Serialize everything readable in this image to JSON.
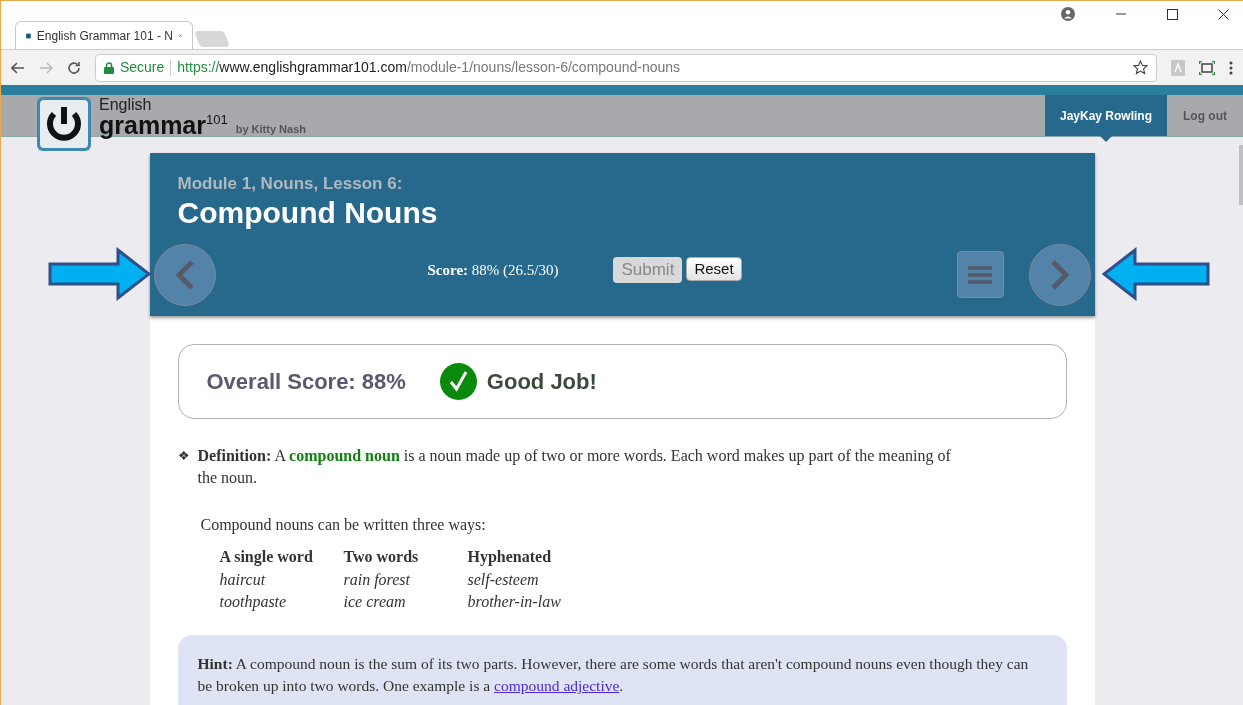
{
  "browser": {
    "tab_title": "English Grammar 101 - N",
    "secure": "Secure",
    "url_scheme": "https://",
    "url_host": "www.englishgrammar101.com",
    "url_path": "/module-1/nouns/lesson-6/compound-nouns"
  },
  "site": {
    "logo_top": "English",
    "logo_main": "grammar",
    "logo_sup": "101",
    "byline": "by Kitty Nash",
    "nav": [
      {
        "label": "JayKay Rowling",
        "selected": true
      },
      {
        "label": "Log out",
        "selected": false
      }
    ]
  },
  "lesson": {
    "subtitle": "Module 1, Nouns, Lesson 6:",
    "title": "Compound Nouns",
    "score_label": "Score:",
    "score_value": "88% (26.5/30)",
    "buttons": [
      {
        "label": "Submit",
        "disabled": true
      },
      {
        "label": "Reset",
        "disabled": false
      }
    ]
  },
  "result": {
    "overall": "Overall Score: 88%",
    "verdict": "Good Job!"
  },
  "definition": {
    "bullet": "❖",
    "label": "Definition:",
    "before": "A",
    "term": "compound noun",
    "after": "is a noun made up of two or more words. Each word makes up part of the meaning of the noun."
  },
  "intro": "Compound nouns can be written three ways:",
  "table": {
    "columns": [
      "A single word",
      "Two words",
      "Hyphenated"
    ],
    "rows": [
      [
        "haircut",
        "rain forest",
        "self-esteem"
      ],
      [
        "toothpaste",
        "ice cream",
        "brother-in-law"
      ]
    ]
  },
  "hint": {
    "label": "Hint:",
    "text": "A compound noun is the sum of its two parts. However, there are some words that aren't compound nouns even though they can be broken up into two words. One example is a",
    "link": "compound adjective",
    "end": "."
  }
}
